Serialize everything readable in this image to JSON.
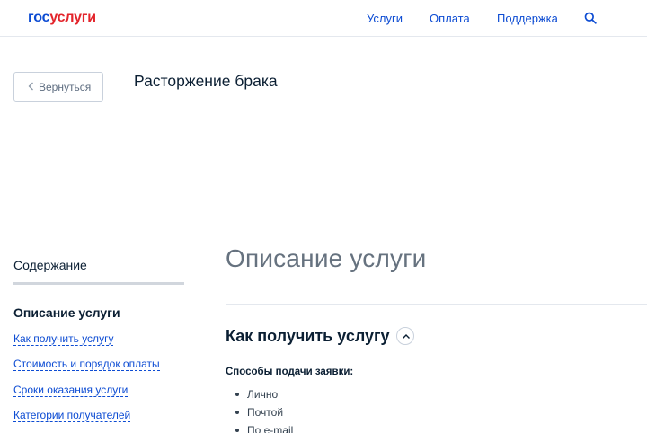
{
  "header": {
    "logo_part1": "гос",
    "logo_part2": "услуги",
    "nav": [
      "Услуги",
      "Оплата",
      "Поддержка"
    ],
    "search_icon": "search-icon"
  },
  "top": {
    "back_label": "Вернуться",
    "service_title": "Расторжение брака"
  },
  "sidebar": {
    "heading": "Содержание",
    "active_item": "Описание услуги",
    "links": [
      "Как получить услугу",
      "Стоимость и порядок оплаты",
      "Сроки оказания услуги",
      "Категории получателей"
    ]
  },
  "main": {
    "title": "Описание услуги",
    "section_heading": "Как получить услугу",
    "collapse_icon": "chevron-up-icon",
    "sub_heading": "Способы подачи заявки:",
    "methods": [
      "Лично",
      "Почтой",
      "По e-mail"
    ]
  },
  "colors": {
    "brand_blue": "#0d4cd3",
    "brand_red": "#e3242b",
    "text_dark": "#0b1f33",
    "title_grey": "#66727f"
  }
}
